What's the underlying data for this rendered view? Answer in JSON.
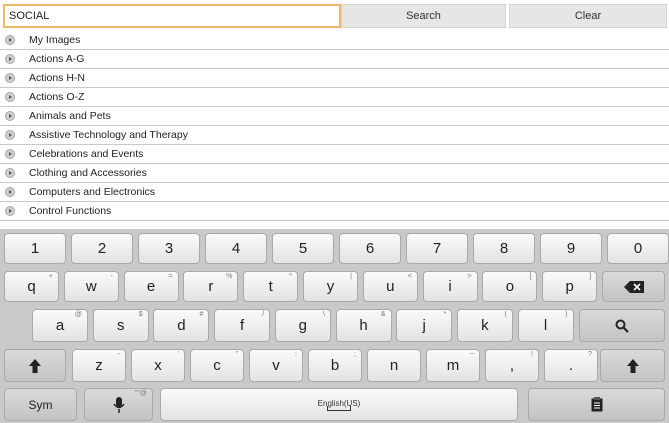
{
  "search": {
    "value": "SOCIAL",
    "search_label": "Search",
    "clear_label": "Clear"
  },
  "categories": [
    "My Images",
    "Actions A-G",
    "Actions H-N",
    "Actions O-Z",
    "Animals and Pets",
    "Assistive Technology and Therapy",
    "Celebrations and Events",
    "Clothing and Accessories",
    "Computers and Electronics",
    "Control Functions"
  ],
  "keyboard": {
    "numbers": [
      "1",
      "2",
      "3",
      "4",
      "5",
      "6",
      "7",
      "8",
      "9",
      "0"
    ],
    "row1": [
      {
        "key": "q",
        "hint": "+"
      },
      {
        "key": "w",
        "hint": "-"
      },
      {
        "key": "e",
        "hint": "="
      },
      {
        "key": "r",
        "hint": "%"
      },
      {
        "key": "t",
        "hint": "^"
      },
      {
        "key": "y",
        "hint": "|"
      },
      {
        "key": "u",
        "hint": "<"
      },
      {
        "key": "i",
        "hint": ">"
      },
      {
        "key": "o",
        "hint": "["
      },
      {
        "key": "p",
        "hint": "]"
      }
    ],
    "row2": [
      {
        "key": "a",
        "hint": "@"
      },
      {
        "key": "s",
        "hint": "$"
      },
      {
        "key": "d",
        "hint": "#"
      },
      {
        "key": "f",
        "hint": "/"
      },
      {
        "key": "g",
        "hint": "\\"
      },
      {
        "key": "h",
        "hint": "&"
      },
      {
        "key": "j",
        "hint": "*"
      },
      {
        "key": "k",
        "hint": "("
      },
      {
        "key": "l",
        "hint": ")"
      }
    ],
    "row3": [
      {
        "key": "z",
        "hint": "-"
      },
      {
        "key": "x",
        "hint": "'"
      },
      {
        "key": "c",
        "hint": "\""
      },
      {
        "key": "v",
        "hint": ":"
      },
      {
        "key": "b",
        "hint": ";"
      },
      {
        "key": "n",
        "hint": ""
      },
      {
        "key": "m",
        "hint": "~"
      },
      {
        "key": ",",
        "hint": "!"
      },
      {
        "key": ".",
        "hint": "?"
      }
    ],
    "sym_label": "Sym",
    "mic_hint": "\"\"@",
    "space_label": "English(US)",
    "icons": {
      "backspace": "backspace-icon",
      "search": "search-icon",
      "shift": "shift-icon",
      "mic": "microphone-icon",
      "clipboard": "clipboard-icon"
    }
  },
  "colors": {
    "input_border": "#f0b56a",
    "keyboard_bg": "#c9c9c9"
  }
}
